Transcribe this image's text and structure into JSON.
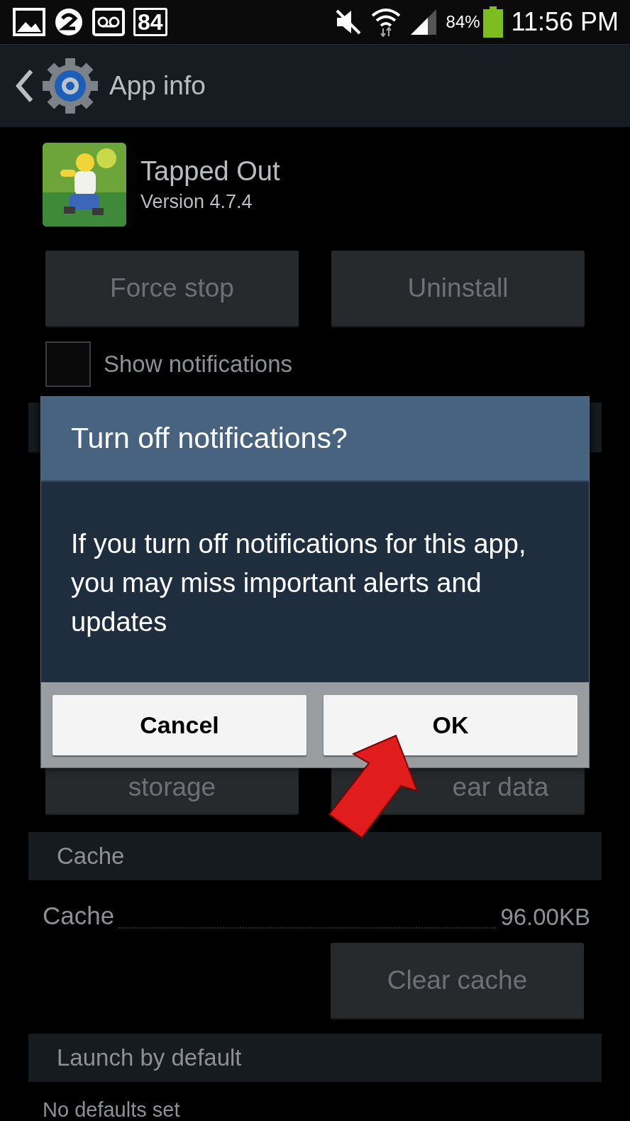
{
  "status_bar": {
    "badge": "84",
    "battery_percent": "84%",
    "time": "11:56 PM"
  },
  "action_bar": {
    "title": "App info"
  },
  "app": {
    "name": "Tapped Out",
    "version": "Version 4.7.4"
  },
  "buttons": [
    {
      "label": "Force stop"
    },
    {
      "label": "Uninstall"
    }
  ],
  "show_notifications": {
    "label": "Show notifications",
    "checked": false
  },
  "storage_buttons": [
    {
      "label": "storage"
    },
    {
      "label": "ear data"
    }
  ],
  "cache": {
    "header": "Cache",
    "label": "Cache",
    "value": "96.00KB",
    "button": "Clear cache"
  },
  "launch_by_default": {
    "header": "Launch by default",
    "text": "No defaults set"
  },
  "dialog": {
    "title": "Turn off notifications?",
    "message": "If you turn off notifications for this app, you may miss important alerts and updates",
    "buttons": [
      {
        "label": "Cancel"
      },
      {
        "label": "OK"
      }
    ]
  }
}
